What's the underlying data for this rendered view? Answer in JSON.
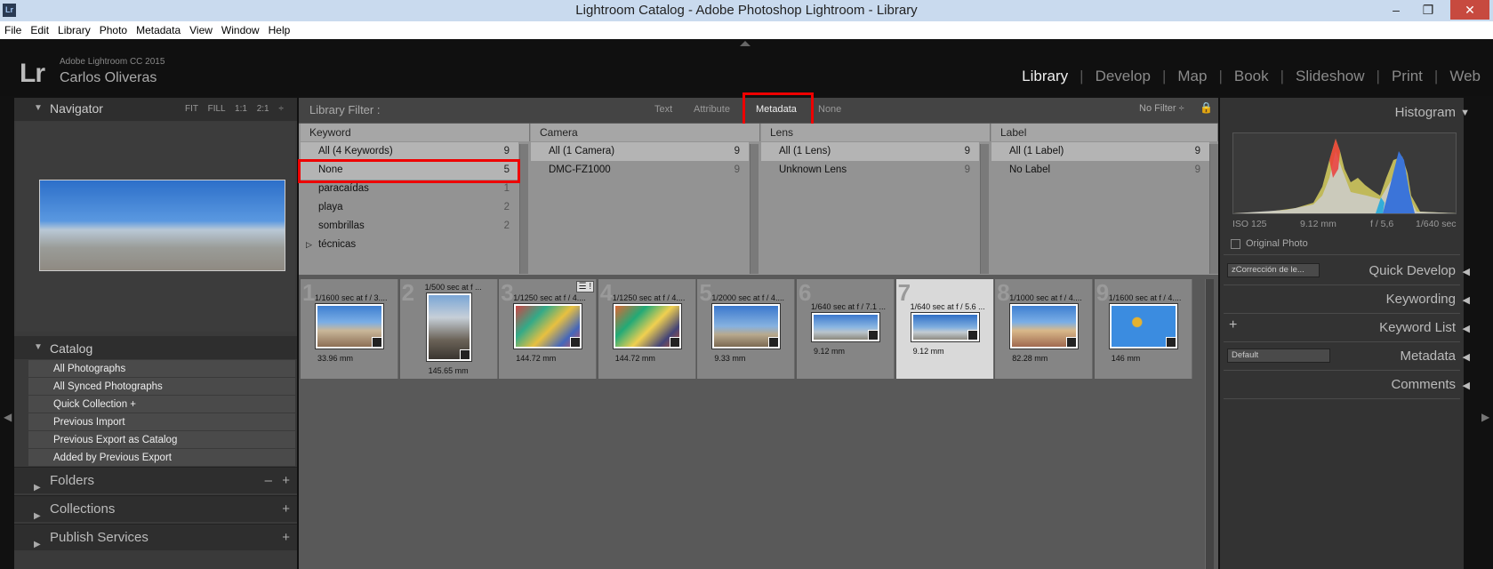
{
  "window": {
    "title": "Lightroom Catalog - Adobe Photoshop Lightroom - Library",
    "app_icon": "Lr"
  },
  "menu": [
    "File",
    "Edit",
    "Library",
    "Photo",
    "Metadata",
    "View",
    "Window",
    "Help"
  ],
  "identity": {
    "logo": "Lr",
    "product": "Adobe Lightroom CC 2015",
    "user": "Carlos Oliveras"
  },
  "modules": [
    "Library",
    "Develop",
    "Map",
    "Book",
    "Slideshow",
    "Print",
    "Web"
  ],
  "navigator": {
    "title": "Navigator",
    "options": "FIT FILL 1:1 2:1 ÷"
  },
  "catalog": {
    "title": "Catalog",
    "items": [
      "All Photographs",
      "All Synced Photographs",
      "Quick Collection  +",
      "Previous Import",
      "Previous Export as Catalog",
      "Added by Previous Export"
    ]
  },
  "left_sections": [
    "Folders",
    "Collections",
    "Publish Services"
  ],
  "filter": {
    "label": "Library Filter :",
    "tabs": [
      "Text",
      "Attribute",
      "Metadata",
      "None"
    ],
    "preset": "No Filter ÷"
  },
  "columns": [
    {
      "title": "Keyword",
      "rows": [
        {
          "label": "All (4 Keywords)",
          "count": "9"
        },
        {
          "label": "None",
          "count": "5"
        },
        {
          "label": "paracaídas",
          "count": "1"
        },
        {
          "label": "playa",
          "count": "2"
        },
        {
          "label": "sombrillas",
          "count": "2"
        },
        {
          "label": "técnicas",
          "count": ""
        }
      ]
    },
    {
      "title": "Camera",
      "rows": [
        {
          "label": "All (1 Camera)",
          "count": "9"
        },
        {
          "label": "DMC-FZ1000",
          "count": "9"
        }
      ]
    },
    {
      "title": "Lens",
      "rows": [
        {
          "label": "All (1 Lens)",
          "count": "9"
        },
        {
          "label": "Unknown Lens",
          "count": "9"
        }
      ]
    },
    {
      "title": "Label",
      "rows": [
        {
          "label": "All (1 Label)",
          "count": "9"
        },
        {
          "label": "No Label",
          "count": "9"
        }
      ]
    }
  ],
  "photos": [
    {
      "num": "1",
      "info": "1/1600 sec at f / 3....",
      "focal": "33.96 mm"
    },
    {
      "num": "2",
      "info": "1/500 sec at f ...",
      "focal": "145.65 mm"
    },
    {
      "num": "3",
      "info": "1/1250 sec at f / 4....",
      "focal": "144.72 mm"
    },
    {
      "num": "4",
      "info": "1/1250 sec at f / 4....",
      "focal": "144.72 mm"
    },
    {
      "num": "5",
      "info": "1/2000 sec at f / 4....",
      "focal": "9.33 mm"
    },
    {
      "num": "6",
      "info": "1/640 sec at f / 7.1 ...",
      "focal": "9.12 mm"
    },
    {
      "num": "7",
      "info": "1/640 sec at f / 5.6 ...",
      "focal": "9.12 mm"
    },
    {
      "num": "8",
      "info": "1/1000 sec at f / 4....",
      "focal": "82.28 mm"
    },
    {
      "num": "9",
      "info": "1/1600 sec at f / 4....",
      "focal": "146 mm"
    }
  ],
  "histogram": {
    "title": "Histogram",
    "iso": "ISO 125",
    "focal": "9.12 mm",
    "aperture": "f / 5,6",
    "shutter": "1/640 sec",
    "original_photo": "Original Photo"
  },
  "right_sections": {
    "quick_develop": "Quick Develop",
    "preset": "zCorrección de le...",
    "keywording": "Keywording",
    "keyword_list": "Keyword List",
    "metadata": "Metadata",
    "metadata_preset": "Default",
    "comments": "Comments"
  }
}
